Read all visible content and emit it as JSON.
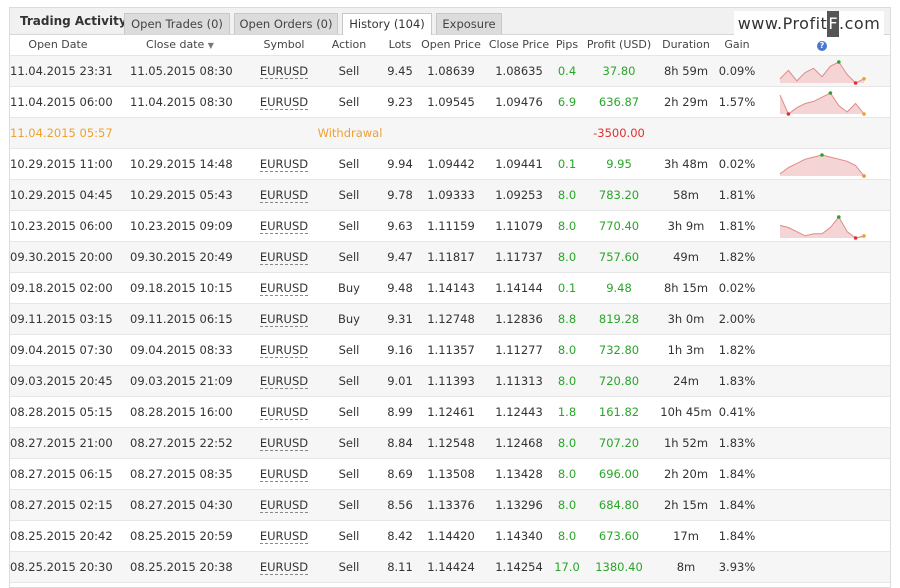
{
  "header": {
    "title": "Trading Activity",
    "tabs": [
      {
        "label": "Open Trades (0)"
      },
      {
        "label": "Open Orders (0)"
      },
      {
        "label": "History (104)"
      },
      {
        "label": "Exposure"
      }
    ],
    "watermark_pre": "www.Profit",
    "watermark_box": "F",
    "watermark_post": ".com"
  },
  "columns": {
    "open_date": "Open Date",
    "close_date": "Close date",
    "symbol": "Symbol",
    "action": "Action",
    "lots": "Lots",
    "open_price": "Open Price",
    "close_price": "Close Price",
    "pips": "Pips",
    "profit": "Profit (USD)",
    "duration": "Duration",
    "gain": "Gain",
    "sort_arrow": "▼",
    "help_icon": "?"
  },
  "colors": {
    "green": "#2aa52a",
    "red": "#e0302f",
    "orange": "#f0a030"
  },
  "rows": [
    {
      "open": "11.04.2015 23:31",
      "close": "11.05.2015 08:30",
      "symbol": "EURUSD",
      "action": "Sell",
      "lots": "9.45",
      "op": "1.08639",
      "cp": "1.08635",
      "pips": "0.4",
      "profit": "37.80",
      "duration": "8h 59m",
      "gain": "0.09%",
      "spark": [
        2,
        6,
        1,
        5,
        7,
        3,
        8,
        10,
        4,
        0,
        2
      ]
    },
    {
      "open": "11.04.2015 06:00",
      "close": "11.04.2015 08:30",
      "symbol": "EURUSD",
      "action": "Sell",
      "lots": "9.23",
      "op": "1.09545",
      "cp": "1.09476",
      "pips": "6.9",
      "profit": "636.87",
      "duration": "2h 29m",
      "gain": "1.57%",
      "spark": [
        9,
        0,
        3,
        5,
        6,
        8,
        10,
        4,
        1,
        5,
        0
      ]
    },
    {
      "type": "withdrawal",
      "open": "11.04.2015 05:57",
      "label": "Withdrawal",
      "profit": "-3500.00"
    },
    {
      "open": "10.29.2015 11:00",
      "close": "10.29.2015 14:48",
      "symbol": "EURUSD",
      "action": "Sell",
      "lots": "9.94",
      "op": "1.09442",
      "cp": "1.09441",
      "pips": "0.1",
      "profit": "9.95",
      "duration": "3h 48m",
      "gain": "0.02%",
      "spark": [
        1,
        4,
        6,
        8,
        9,
        10,
        9,
        8,
        7,
        5,
        0
      ]
    },
    {
      "open": "10.29.2015 04:45",
      "close": "10.29.2015 05:43",
      "symbol": "EURUSD",
      "action": "Sell",
      "lots": "9.78",
      "op": "1.09333",
      "cp": "1.09253",
      "pips": "8.0",
      "profit": "783.20",
      "duration": "58m",
      "gain": "1.81%"
    },
    {
      "open": "10.23.2015 06:00",
      "close": "10.23.2015 09:09",
      "symbol": "EURUSD",
      "action": "Sell",
      "lots": "9.63",
      "op": "1.11159",
      "cp": "1.11079",
      "pips": "8.0",
      "profit": "770.40",
      "duration": "3h 9m",
      "gain": "1.81%",
      "spark": [
        6,
        5,
        3,
        1,
        2,
        2,
        5,
        10,
        3,
        0,
        1
      ]
    },
    {
      "open": "09.30.2015 20:00",
      "close": "09.30.2015 20:49",
      "symbol": "EURUSD",
      "action": "Sell",
      "lots": "9.47",
      "op": "1.11817",
      "cp": "1.11737",
      "pips": "8.0",
      "profit": "757.60",
      "duration": "49m",
      "gain": "1.82%"
    },
    {
      "open": "09.18.2015 02:00",
      "close": "09.18.2015 10:15",
      "symbol": "EURUSD",
      "action": "Buy",
      "lots": "9.48",
      "op": "1.14143",
      "cp": "1.14144",
      "pips": "0.1",
      "profit": "9.48",
      "duration": "8h 15m",
      "gain": "0.02%"
    },
    {
      "open": "09.11.2015 03:15",
      "close": "09.11.2015 06:15",
      "symbol": "EURUSD",
      "action": "Buy",
      "lots": "9.31",
      "op": "1.12748",
      "cp": "1.12836",
      "pips": "8.8",
      "profit": "819.28",
      "duration": "3h 0m",
      "gain": "2.00%"
    },
    {
      "open": "09.04.2015 07:30",
      "close": "09.04.2015 08:33",
      "symbol": "EURUSD",
      "action": "Sell",
      "lots": "9.16",
      "op": "1.11357",
      "cp": "1.11277",
      "pips": "8.0",
      "profit": "732.80",
      "duration": "1h 3m",
      "gain": "1.82%"
    },
    {
      "open": "09.03.2015 20:45",
      "close": "09.03.2015 21:09",
      "symbol": "EURUSD",
      "action": "Sell",
      "lots": "9.01",
      "op": "1.11393",
      "cp": "1.11313",
      "pips": "8.0",
      "profit": "720.80",
      "duration": "24m",
      "gain": "1.83%"
    },
    {
      "open": "08.28.2015 05:15",
      "close": "08.28.2015 16:00",
      "symbol": "EURUSD",
      "action": "Sell",
      "lots": "8.99",
      "op": "1.12461",
      "cp": "1.12443",
      "pips": "1.8",
      "profit": "161.82",
      "duration": "10h 45m",
      "gain": "0.41%"
    },
    {
      "open": "08.27.2015 21:00",
      "close": "08.27.2015 22:52",
      "symbol": "EURUSD",
      "action": "Sell",
      "lots": "8.84",
      "op": "1.12548",
      "cp": "1.12468",
      "pips": "8.0",
      "profit": "707.20",
      "duration": "1h 52m",
      "gain": "1.83%"
    },
    {
      "open": "08.27.2015 06:15",
      "close": "08.27.2015 08:35",
      "symbol": "EURUSD",
      "action": "Sell",
      "lots": "8.69",
      "op": "1.13508",
      "cp": "1.13428",
      "pips": "8.0",
      "profit": "696.00",
      "duration": "2h 20m",
      "gain": "1.84%"
    },
    {
      "open": "08.27.2015 02:15",
      "close": "08.27.2015 04:30",
      "symbol": "EURUSD",
      "action": "Sell",
      "lots": "8.56",
      "op": "1.13376",
      "cp": "1.13296",
      "pips": "8.0",
      "profit": "684.80",
      "duration": "2h 15m",
      "gain": "1.84%"
    },
    {
      "open": "08.25.2015 20:42",
      "close": "08.25.2015 20:59",
      "symbol": "EURUSD",
      "action": "Sell",
      "lots": "8.42",
      "op": "1.14420",
      "cp": "1.14340",
      "pips": "8.0",
      "profit": "673.60",
      "duration": "17m",
      "gain": "1.84%"
    },
    {
      "open": "08.25.2015 20:30",
      "close": "08.25.2015 20:38",
      "symbol": "EURUSD",
      "action": "Sell",
      "lots": "8.11",
      "op": "1.14424",
      "cp": "1.14254",
      "pips": "17.0",
      "profit": "1380.40",
      "duration": "8m",
      "gain": "3.93%"
    }
  ]
}
